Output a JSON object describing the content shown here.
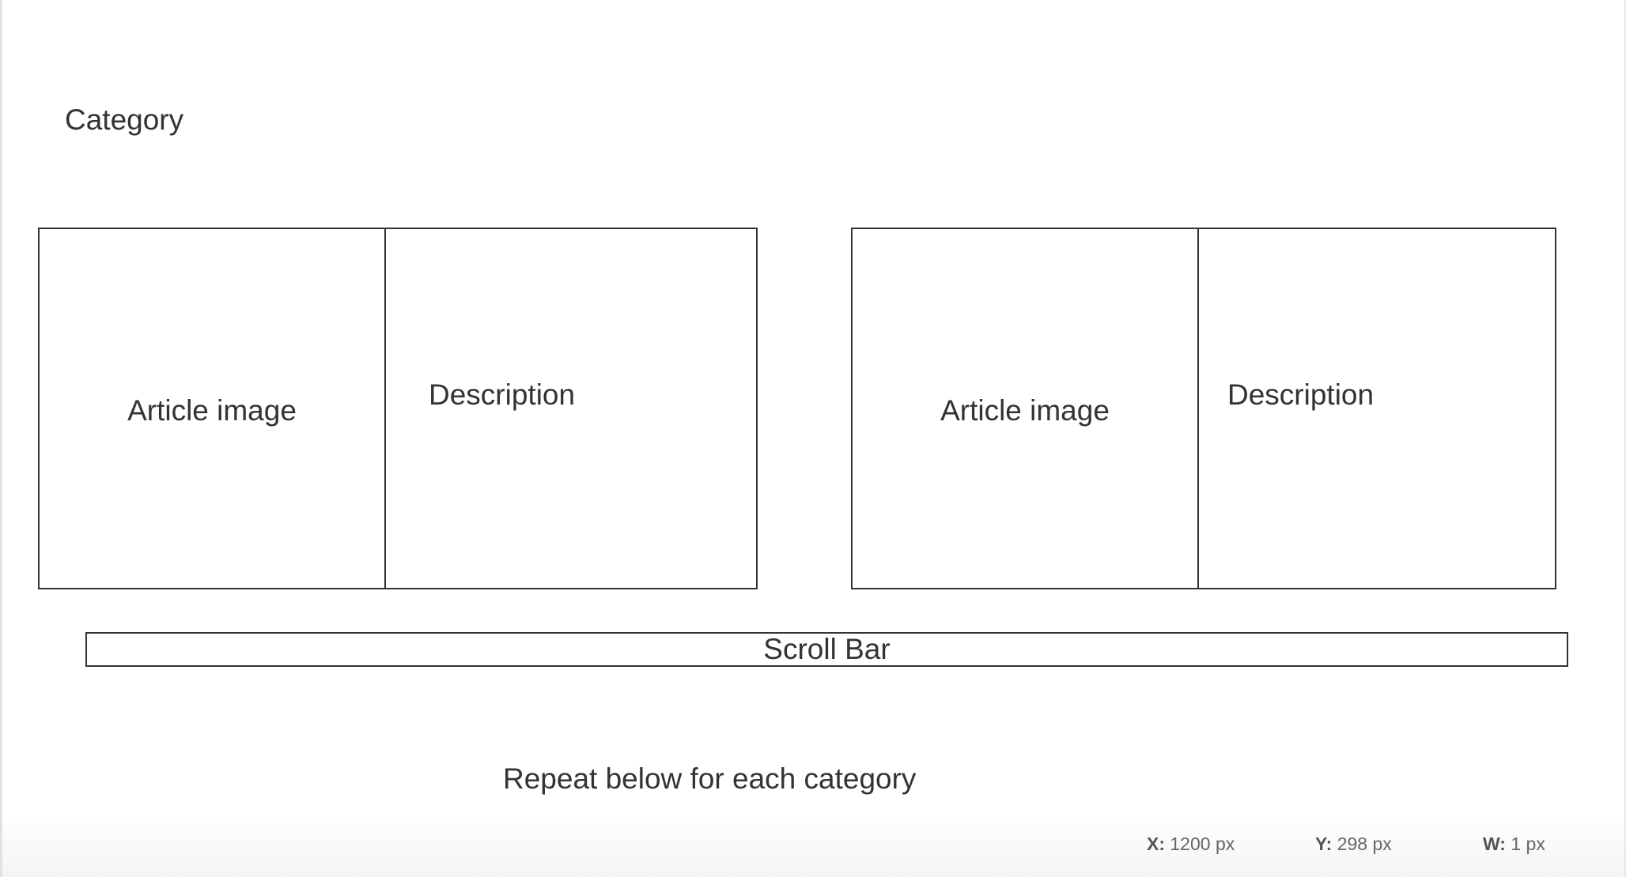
{
  "category": {
    "title": "Category"
  },
  "cards": [
    {
      "image_label": "Article image",
      "description_label": "Description"
    },
    {
      "image_label": "Article image",
      "description_label": "Description"
    }
  ],
  "scrollbar": {
    "label": "Scroll Bar"
  },
  "note": {
    "text": "Repeat below for each category"
  },
  "status": {
    "x_key": "X:",
    "x_value": "1200 px",
    "y_key": "Y:",
    "y_value": "298 px",
    "w_key": "W:",
    "w_value": "1 px"
  }
}
